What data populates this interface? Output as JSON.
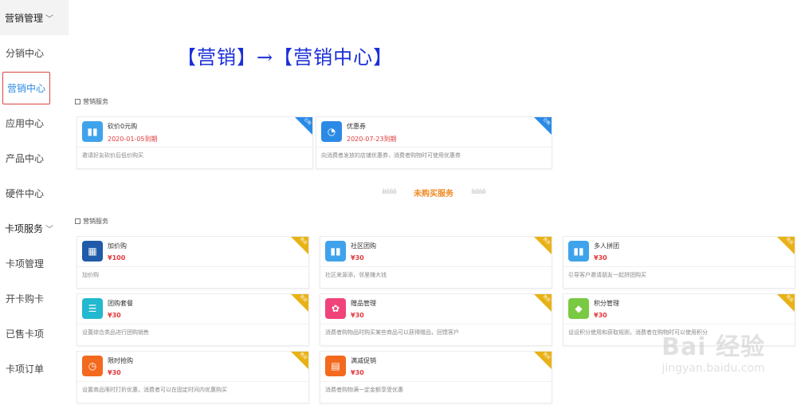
{
  "sidebar": {
    "section1": "营销管理",
    "items1": [
      "分销中心",
      "营销中心",
      "应用中心",
      "产品中心",
      "硬件中心"
    ],
    "section2": "卡项服务",
    "items2": [
      "卡项管理",
      "开卡购卡",
      "已售卡项",
      "卡项订单"
    ]
  },
  "title": "【营销】→【营销中心】",
  "purchased": {
    "header": "营销服务",
    "cards": [
      {
        "name": "砍价0元购",
        "date": "2020-01-05到期",
        "desc": "邀请好友砍价后低价购买",
        "tag": "已购",
        "color": "#3fa3ec"
      },
      {
        "name": "优惠券",
        "date": "2020-07-23到期",
        "desc": "向消费者发放的店铺优惠券，消费者购物时可使用优惠券",
        "tag": "已购",
        "color": "#2b8ae6"
      }
    ]
  },
  "divider": {
    "label": "未购买服务"
  },
  "unpurchased": {
    "header": "营销服务",
    "cards": [
      {
        "name": "加价购",
        "price": "¥100",
        "desc": "加价购",
        "tag": "购买",
        "color": "#1f5ba8"
      },
      {
        "name": "社区团购",
        "price": "¥30",
        "desc": "社区来源添，邻里赚大钱",
        "tag": "购买",
        "color": "#3fa3ec"
      },
      {
        "name": "多人拼团",
        "price": "¥30",
        "desc": "引导客户邀请朋友一起拼团购买",
        "tag": "购买",
        "color": "#3fa3ec"
      },
      {
        "name": "团购套餐",
        "price": "¥30",
        "desc": "设置综合类品进行团购销售",
        "tag": "购买",
        "color": "#22b8cf"
      },
      {
        "name": "赠品管理",
        "price": "¥30",
        "desc": "消费者购物品时购买某些商品可以获得赠品，回馈客户",
        "tag": "购买",
        "color": "#f0437a"
      },
      {
        "name": "积分管理",
        "price": "¥30",
        "desc": "设设积分使用和获取规则，消费者在购物时可以使用积分",
        "tag": "购买",
        "color": "#7ac943"
      },
      {
        "name": "限时抢购",
        "price": "¥30",
        "desc": "设置商品限时打折优惠，消费者可以在固定时间内优惠购买",
        "tag": "购买",
        "color": "#f36a1f"
      },
      {
        "name": "满减促销",
        "price": "¥30",
        "desc": "消费者购物满一定金额享受优惠",
        "tag": "购买",
        "color": "#f36a1f"
      }
    ]
  },
  "watermark": {
    "main": "Bai 经验",
    "sub": "jingyan.baidu.com"
  }
}
